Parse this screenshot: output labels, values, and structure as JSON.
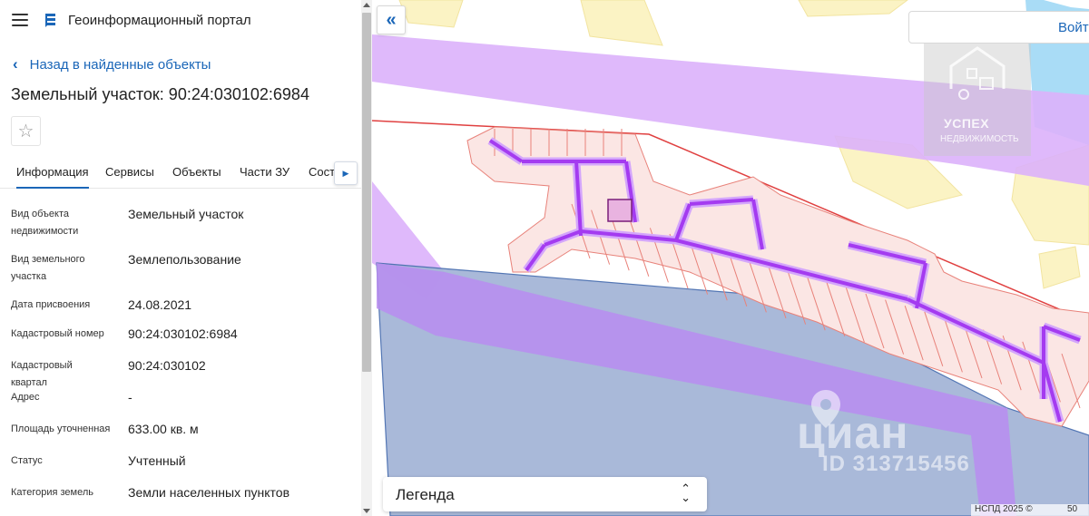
{
  "header": {
    "app_title": "Геоинформационный портал"
  },
  "nav": {
    "back_label": "Назад в найденные объекты"
  },
  "object": {
    "title": "Земельный участок: 90:24:030102:6984"
  },
  "tabs": [
    "Информация",
    "Сервисы",
    "Объекты",
    "Части ЗУ",
    "Соста"
  ],
  "active_tab": "Информация",
  "info": [
    {
      "label": "Вид объекта недвижимости",
      "value": "Земельный участок"
    },
    {
      "label": "Вид земельного участка",
      "value": "Землепользование"
    },
    {
      "label": "Дата присвоения",
      "value": "24.08.2021"
    },
    {
      "label": "Кадастровый номер",
      "value": "90:24:030102:6984"
    },
    {
      "label": "Кадастровый квартал",
      "value": "90:24:030102"
    },
    {
      "label": "Адрес",
      "value": "-"
    },
    {
      "label": "Площадь уточненная",
      "value": "633.00 кв. м"
    },
    {
      "label": "Статус",
      "value": "Учтенный"
    },
    {
      "label": "Категория земель",
      "value": "Земли населенных пунктов"
    }
  ],
  "map": {
    "login_label": "Войти",
    "legend_label": "Легенда",
    "copyright": "НСПД 2025 ©",
    "scale_label": "50",
    "watermark_brand": "УСПЕХ",
    "watermark_sub": "НЕДВИЖИМОСТЬ",
    "watermark_cian": "циан",
    "watermark_cian_id": "ID 313715456"
  },
  "colors": {
    "accent": "#1a66b8",
    "zone_purple": "#c07cf5",
    "zone_blue": "#a5b6d8",
    "parcel_fill": "#fbe6e4",
    "parcel_stroke": "#e8827a",
    "road": "#a43bf0",
    "yellow_zone": "#fbf3c4",
    "water": "#a9dcf6"
  }
}
